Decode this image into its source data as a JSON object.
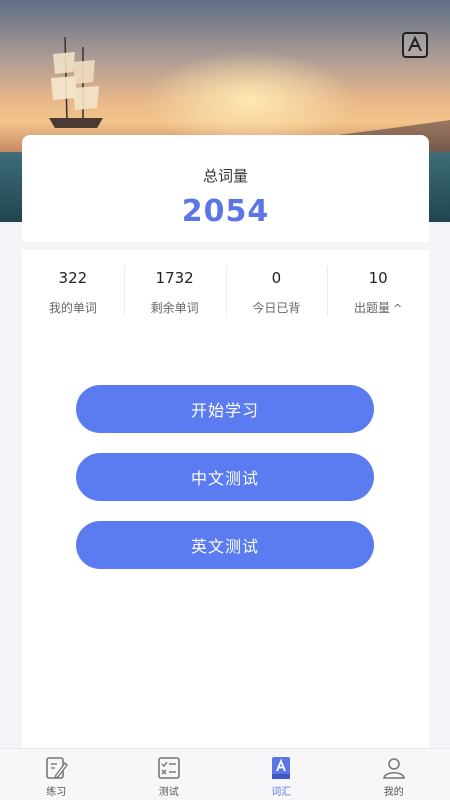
{
  "header": {
    "dictionary_icon": "dictionary-a-icon"
  },
  "summary": {
    "label": "总词量",
    "total": "2054"
  },
  "stats": [
    {
      "value": "322",
      "label": "我的单词"
    },
    {
      "value": "1732",
      "label": "剩余单词"
    },
    {
      "value": "0",
      "label": "今日已背"
    },
    {
      "value": "10",
      "label": "出题量",
      "chevron": "^"
    }
  ],
  "actions": {
    "start": "开始学习",
    "chinese_test": "中文测试",
    "english_test": "英文测试"
  },
  "tabbar": {
    "items": [
      {
        "label": "练习",
        "icon": "pencil-note-icon"
      },
      {
        "label": "测试",
        "icon": "checklist-icon"
      },
      {
        "label": "词汇",
        "icon": "vocabulary-book-icon"
      },
      {
        "label": "我的",
        "icon": "person-icon"
      }
    ],
    "active_index": 2
  },
  "colors": {
    "accent": "#5b7bf0",
    "total_text": "#5b76e6"
  }
}
